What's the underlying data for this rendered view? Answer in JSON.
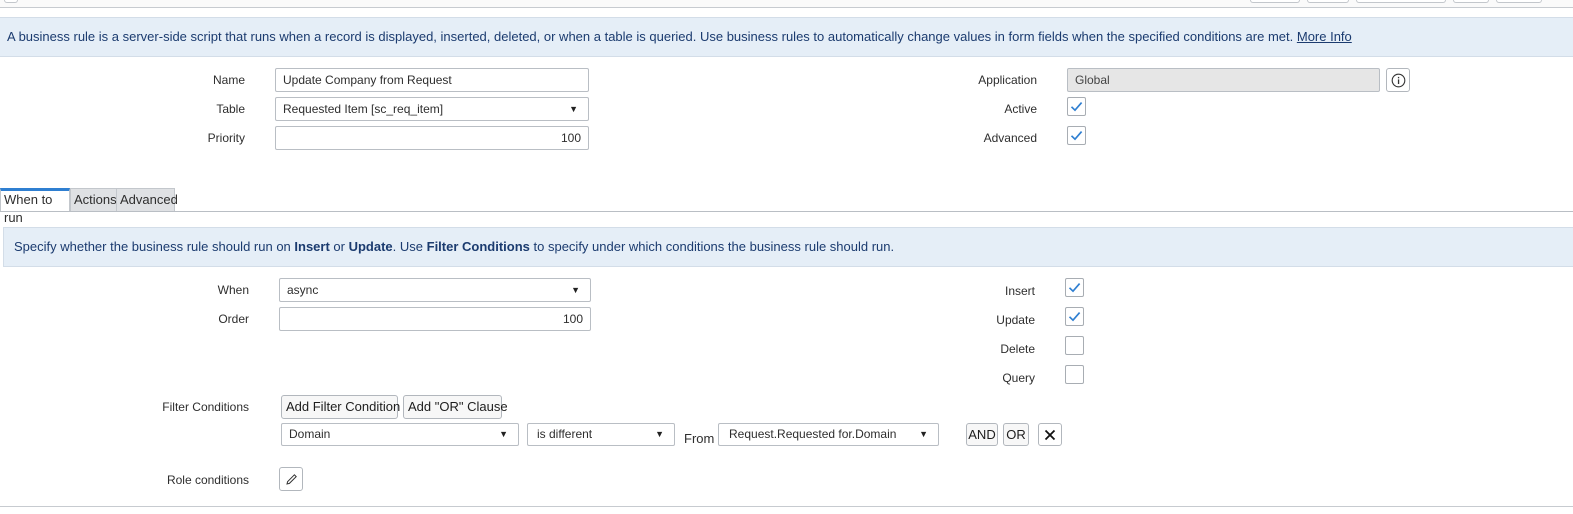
{
  "banner": {
    "text": "A business rule is a server-side script that runs when a record is displayed, inserted, deleted, or when a table is queried. Use business rules to automatically change values in form fields when the specified conditions are met.",
    "link": "More Info"
  },
  "form": {
    "name_label": "Name",
    "name_value": "Update Company from Request",
    "table_label": "Table",
    "table_value": "Requested Item [sc_req_item]",
    "priority_label": "Priority",
    "priority_value": "100",
    "application_label": "Application",
    "application_value": "Global",
    "active_label": "Active",
    "active_checked": true,
    "advanced_label": "Advanced",
    "advanced_checked": true
  },
  "tabs": [
    {
      "label": "When to run",
      "active": true
    },
    {
      "label": "Actions",
      "active": false
    },
    {
      "label": "Advanced",
      "active": false
    }
  ],
  "when_info": {
    "p1": "Specify whether the business rule should run on ",
    "b1": "Insert",
    "p2": " or ",
    "b2": "Update",
    "p3": ". Use ",
    "b3": "Filter Conditions",
    "p4": " to specify under which conditions the business rule should run."
  },
  "when_to_run": {
    "when_label": "When",
    "when_value": "async",
    "order_label": "Order",
    "order_value": "100",
    "insert_label": "Insert",
    "insert_checked": true,
    "update_label": "Update",
    "update_checked": true,
    "delete_label": "Delete",
    "delete_checked": false,
    "query_label": "Query",
    "query_checked": false,
    "filter_label": "Filter Conditions",
    "add_filter_label": "Add Filter Condition",
    "add_or_label": "Add \"OR\" Clause",
    "condition": {
      "field": "Domain",
      "operator": "is different",
      "from_label": "From",
      "value": "Request.Requested for.Domain",
      "and_label": "AND",
      "or_label": "OR"
    },
    "role_label": "Role conditions"
  },
  "icons": [
    "checkmark-icon",
    "info-icon",
    "dropdown-arrow-icon",
    "close-icon",
    "pencil-icon"
  ],
  "colors": {
    "accent": "#2f7fd1",
    "info_bg": "#e5eef7",
    "info_text": "#1b3b6f",
    "readonly_bg": "#e6e6e6"
  }
}
